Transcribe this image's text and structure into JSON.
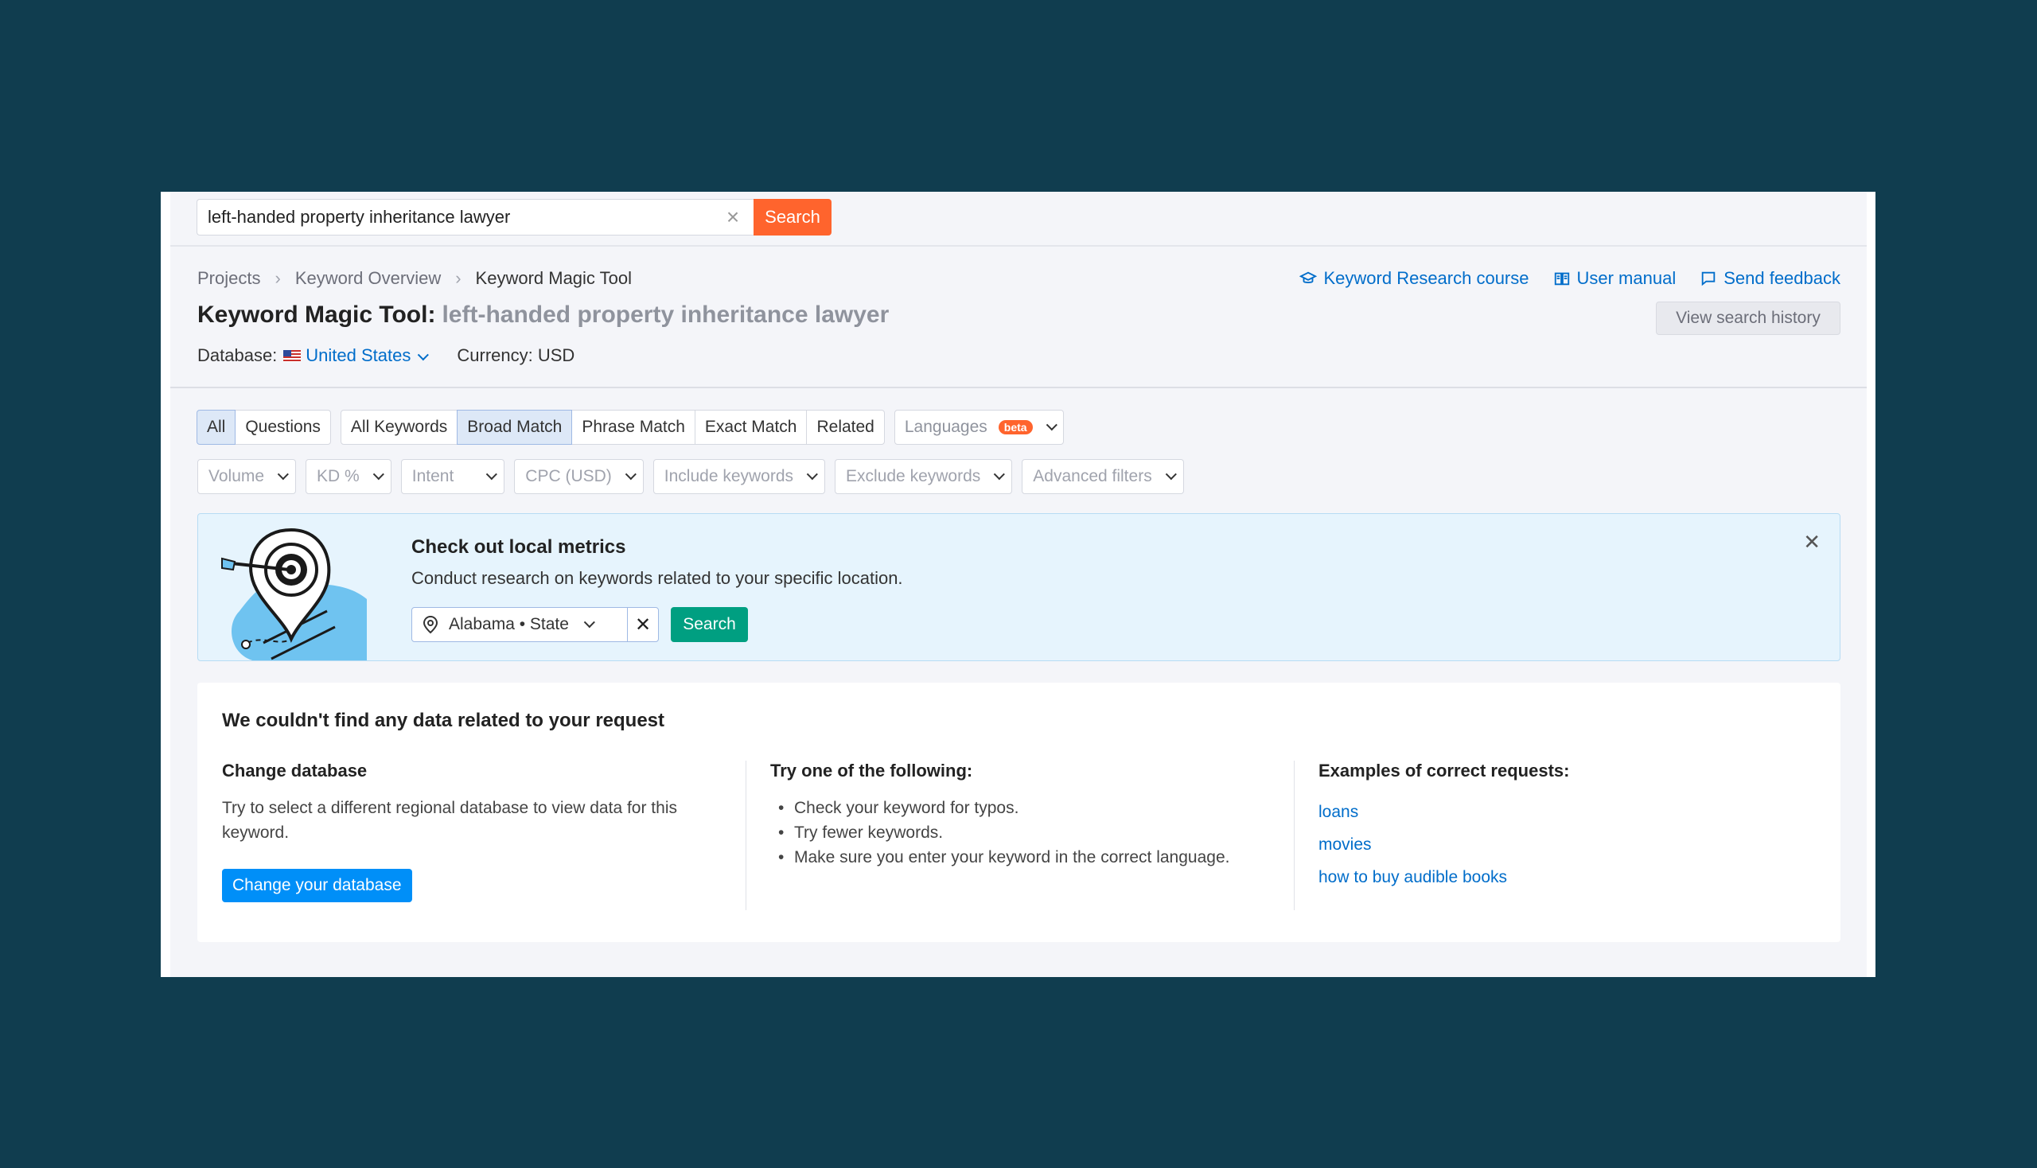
{
  "search": {
    "query": "left-handed property inheritance lawyer",
    "clear_icon": "close-icon",
    "button_label": "Search"
  },
  "breadcrumb": [
    "Projects",
    "Keyword Overview",
    "Keyword Magic Tool"
  ],
  "header": {
    "title": "Keyword Magic Tool:",
    "query": "left-handed property inheritance lawyer",
    "database_label": "Database:",
    "database_value": "United States",
    "currency": "Currency: USD",
    "links": {
      "course": "Keyword Research course",
      "manual": "User manual",
      "feedback": "Send feedback"
    },
    "history_button": "View search history"
  },
  "tabs": {
    "group1": [
      "All",
      "Questions"
    ],
    "group2": [
      "All Keywords",
      "Broad Match",
      "Phrase Match",
      "Exact Match",
      "Related"
    ],
    "active": [
      "All",
      "Broad Match"
    ],
    "languages": "Languages",
    "beta": "beta"
  },
  "filters": [
    "Volume",
    "KD %",
    "Intent",
    "CPC (USD)",
    "Include keywords",
    "Exclude keywords",
    "Advanced filters"
  ],
  "local": {
    "title": "Check out local metrics",
    "description": "Conduct research on keywords related to your specific location.",
    "location": "Alabama • State",
    "search_button": "Search"
  },
  "nodata": {
    "title": "We couldn't find any data related to your request",
    "col1": {
      "heading": "Change database",
      "text": "Try to select a different regional database to view data for this keyword.",
      "button": "Change your database"
    },
    "col2": {
      "heading": "Try one of the following:",
      "items": [
        "Check your keyword for typos.",
        "Try fewer keywords.",
        "Make sure you enter your keyword in the correct language."
      ]
    },
    "col3": {
      "heading": "Examples of correct requests:",
      "examples": [
        "loans",
        "movies",
        "how to buy audible books"
      ]
    }
  },
  "colors": {
    "background": "#103d4f",
    "accent_orange": "#ff642d",
    "link_blue": "#006dca",
    "green": "#009f81",
    "button_blue": "#008ff8"
  }
}
